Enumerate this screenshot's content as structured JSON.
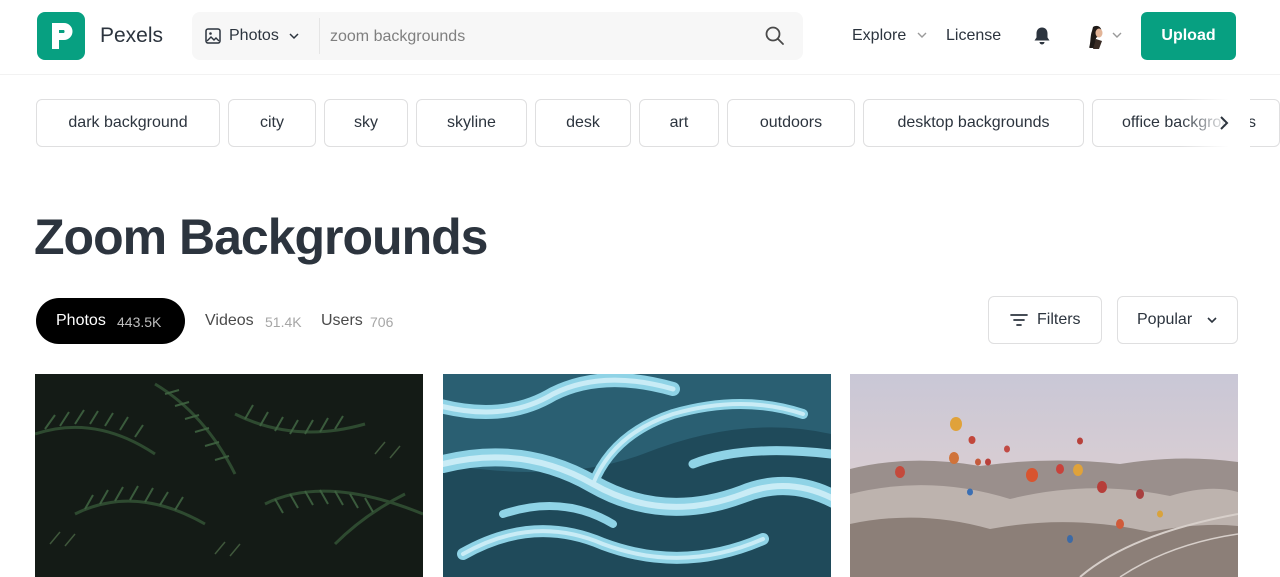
{
  "header": {
    "brand": "Pexels",
    "brand_color": "#07a081",
    "search": {
      "type_label": "Photos",
      "value": "zoom backgrounds",
      "placeholder": "zoom backgrounds"
    },
    "nav": {
      "explore": "Explore",
      "license": "License"
    },
    "upload_label": "Upload"
  },
  "chips": [
    "dark background",
    "city",
    "sky",
    "skyline",
    "desk",
    "art",
    "outdoors",
    "desktop backgrounds",
    "office backgrounds"
  ],
  "page_title": "Zoom Backgrounds",
  "tabs": [
    {
      "label": "Photos",
      "count": "443.5K",
      "active": true
    },
    {
      "label": "Videos",
      "count": "51.4K",
      "active": false
    },
    {
      "label": "Users",
      "count": "706",
      "active": false
    }
  ],
  "controls": {
    "filters_label": "Filters",
    "sort_label": "Popular"
  },
  "photos": [
    {
      "subject": "dark green fern leaves"
    },
    {
      "subject": "aerial view of blue braided river"
    },
    {
      "subject": "hot air balloons over valley at sunrise"
    }
  ]
}
